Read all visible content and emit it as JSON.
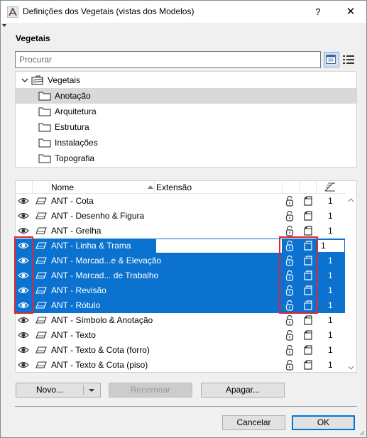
{
  "window": {
    "title": "Definições dos Vegetais (vistas dos Modelos)",
    "help_label": "?",
    "close_label": "✕"
  },
  "section_title": "Vegetais",
  "search": {
    "placeholder": "Procurar"
  },
  "tree": {
    "root": "Vegetais",
    "folders": [
      {
        "label": "Anotação",
        "selected": true
      },
      {
        "label": "Arquitetura",
        "selected": false
      },
      {
        "label": "Estrutura",
        "selected": false
      },
      {
        "label": "Instalações",
        "selected": false
      },
      {
        "label": "Topografia",
        "selected": false
      }
    ]
  },
  "table": {
    "columns": {
      "name": "Nome",
      "extension": "Extensão"
    },
    "rows": [
      {
        "name": "ANT - Cota",
        "extension": "",
        "number": "1",
        "selected": false
      },
      {
        "name": "ANT - Desenho & Figura",
        "extension": "",
        "number": "1",
        "selected": false
      },
      {
        "name": "ANT - Grelha",
        "extension": "",
        "number": "1",
        "selected": false
      },
      {
        "name": "ANT - Linha & Trama",
        "extension": "",
        "number": "1",
        "selected": true,
        "editing": true
      },
      {
        "name": "ANT - Marcad...e & Elevação",
        "extension": "",
        "number": "1",
        "selected": true
      },
      {
        "name": "ANT - Marcad... de Trabalho",
        "extension": "",
        "number": "1",
        "selected": true
      },
      {
        "name": "ANT - Revisão",
        "extension": "",
        "number": "1",
        "selected": true
      },
      {
        "name": "ANT - Rótulo",
        "extension": "",
        "number": "1",
        "selected": true
      },
      {
        "name": "ANT - Símbolo & Anotação",
        "extension": "",
        "number": "1",
        "selected": false
      },
      {
        "name": "ANT - Texto",
        "extension": "",
        "number": "1",
        "selected": false
      },
      {
        "name": "ANT - Texto & Cota (forro)",
        "extension": "",
        "number": "1",
        "selected": false
      },
      {
        "name": "ANT - Texto & Cota (piso)",
        "extension": "",
        "number": "1",
        "selected": false
      }
    ]
  },
  "buttons": {
    "new": "Novo...",
    "rename": "Renomear",
    "delete": "Apagar...",
    "cancel": "Cancelar",
    "ok": "OK"
  },
  "icons": {
    "app": "archicad-icon",
    "visibility": "eye-icon",
    "layer": "layer-icon",
    "lock": "lock-icon",
    "wireframe": "wireframe-icon",
    "intersection": "intersection-group-icon"
  },
  "colors": {
    "selection": "#0b72d0",
    "tree_selection": "#d9d9d9",
    "highlight_box": "#e0262e"
  }
}
